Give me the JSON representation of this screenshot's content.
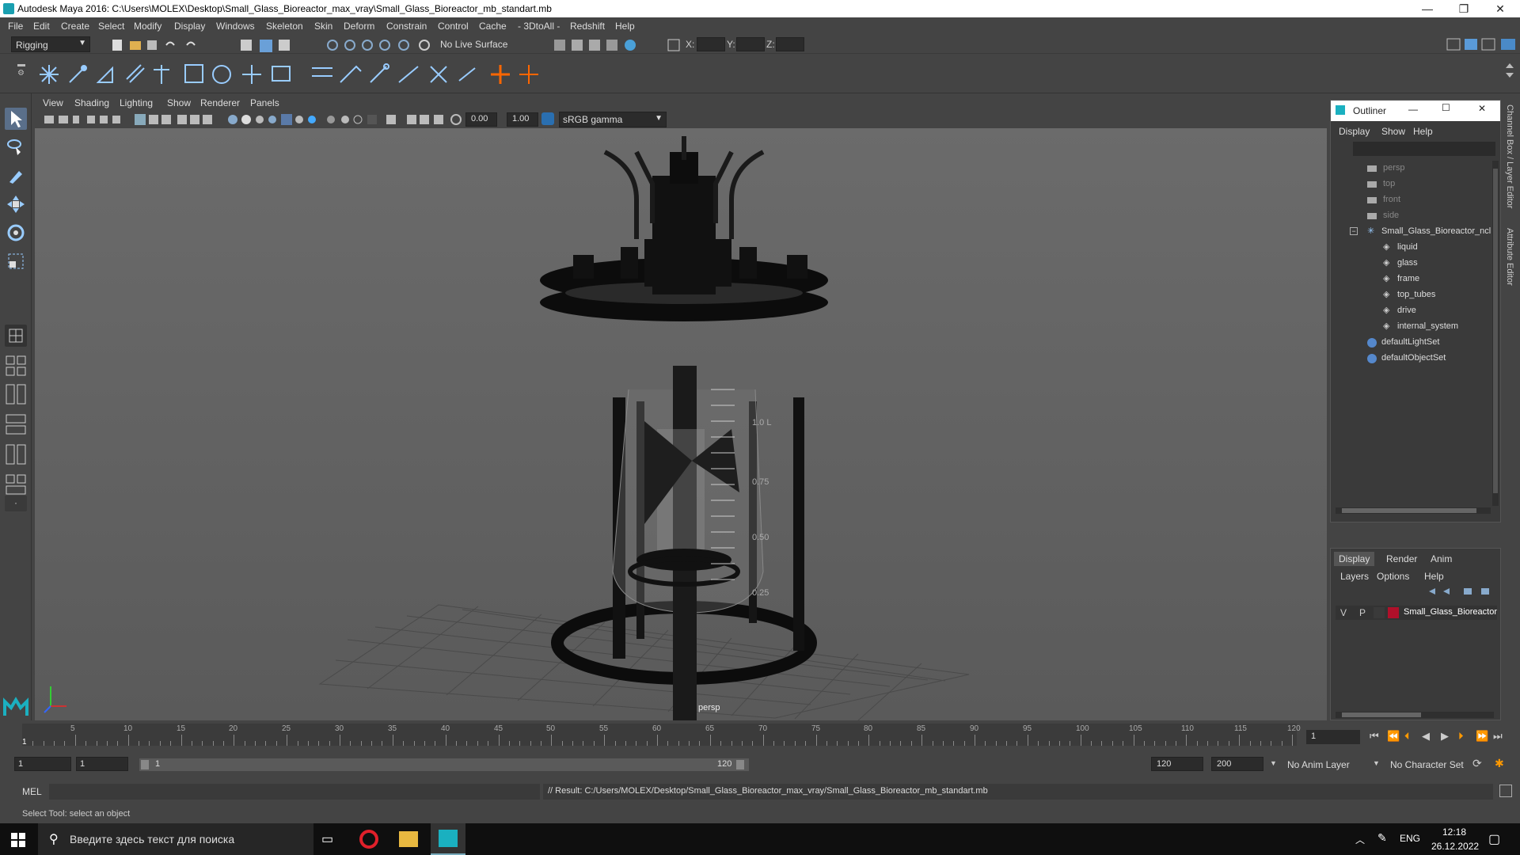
{
  "window": {
    "title": "Autodesk Maya 2016: C:\\Users\\MOLEX\\Desktop\\Small_Glass_Bioreactor_max_vray\\Small_Glass_Bioreactor_mb_standart.mb",
    "minimize": "—",
    "restore": "❐",
    "close": "✕"
  },
  "menubar": [
    "File",
    "Edit",
    "Create",
    "Select",
    "Modify",
    "Display",
    "Windows",
    "Skeleton",
    "Skin",
    "Deform",
    "Constrain",
    "Control",
    "Cache",
    "- 3DtoAll -",
    "Redshift",
    "Help"
  ],
  "statusline": {
    "mode": "Rigging",
    "live_surface": "No Live Surface",
    "x_label": "X:",
    "y_label": "Y:",
    "z_label": "Z:"
  },
  "viewport": {
    "menu": [
      "View",
      "Shading",
      "Lighting",
      "Show",
      "Renderer",
      "Panels"
    ],
    "exposure": "0.00",
    "gamma": "1.00",
    "color_space": "sRGB gamma",
    "camera": "persp",
    "beaker_labels": [
      "1.0 L",
      "0.75",
      "0.50",
      "0.25"
    ]
  },
  "outliner": {
    "title": "Outliner",
    "menu": [
      "Display",
      "Show",
      "Help"
    ],
    "cameras": [
      "persp",
      "top",
      "front",
      "side"
    ],
    "root": "Small_Glass_Bioreactor_ncl",
    "children": [
      "liquid",
      "glass",
      "frame",
      "top_tubes",
      "drive",
      "internal_system"
    ],
    "sets": [
      "defaultLightSet",
      "defaultObjectSet"
    ]
  },
  "layer_panel": {
    "tabs": [
      "Display",
      "Render",
      "Anim"
    ],
    "menu": [
      "Layers",
      "Options",
      "Help"
    ],
    "layer": {
      "v": "V",
      "p": "P",
      "name": "Small_Glass_Bioreactor",
      "color": "#b0102a"
    }
  },
  "vertical_tabs": [
    "Channel Box / Layer Editor",
    "Attribute Editor"
  ],
  "timeslider": {
    "ticks": [
      5,
      10,
      15,
      20,
      25,
      30,
      35,
      40,
      45,
      50,
      55,
      60,
      65,
      70,
      75,
      80,
      85,
      90,
      95,
      100,
      105,
      110,
      115,
      120
    ],
    "start_frame_label": "1",
    "current_frame": "1"
  },
  "range": {
    "start": "1",
    "start_inner": "1",
    "range_start": "1",
    "range_end": "120",
    "end_inner": "120",
    "end": "200",
    "anim_layer": "No Anim Layer",
    "character_set": "No Character Set"
  },
  "cmdline": {
    "lang": "MEL",
    "result": "// Result: C:/Users/MOLEX/Desktop/Small_Glass_Bioreactor_max_vray/Small_Glass_Bioreactor_mb_standart.mb"
  },
  "helpline": "Select Tool: select an object",
  "taskbar": {
    "search_placeholder": "Введите здесь текст для поиска",
    "lang": "ENG",
    "time": "12:18",
    "date": "26.12.2022"
  }
}
